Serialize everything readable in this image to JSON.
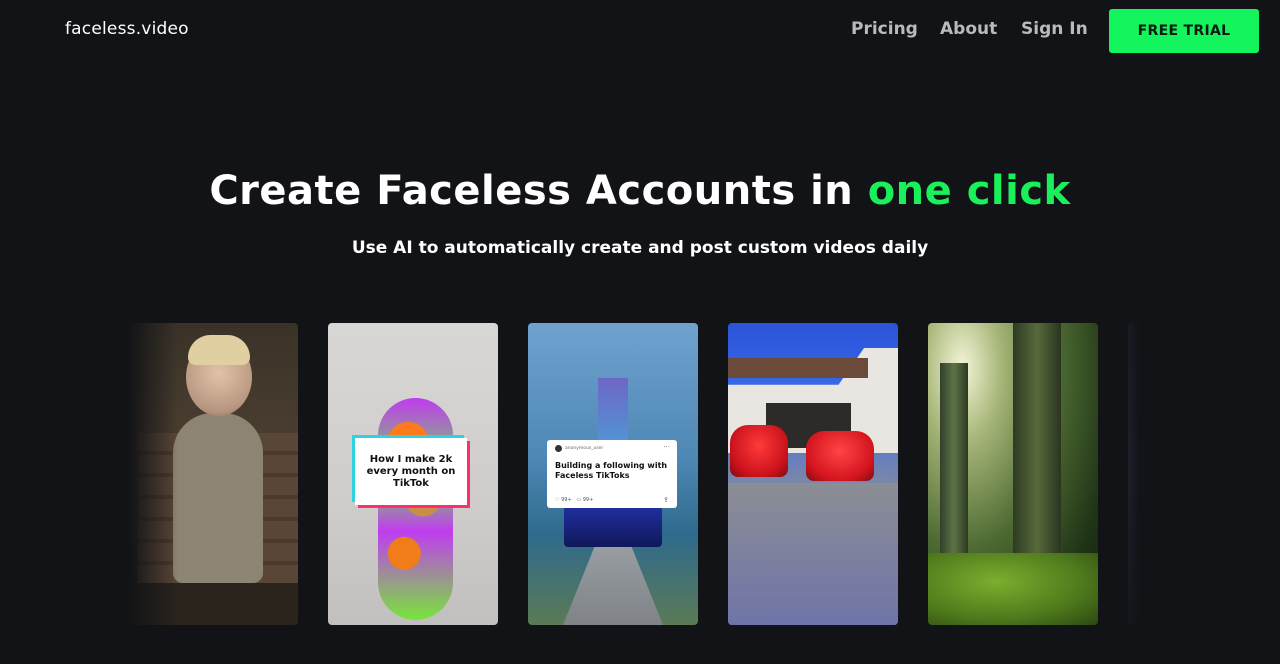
{
  "nav": {
    "logo": "faceless.video",
    "links": [
      "Pricing",
      "About",
      "Sign In"
    ],
    "cta": "FREE TRIAL",
    "accent_color": "#14f45c"
  },
  "hero": {
    "title_main": "Create Faceless Accounts in ",
    "title_accent": "one click",
    "subtitle": "Use AI to automatically create and post custom videos daily"
  },
  "carousel": {
    "cards": [
      {
        "caption": ""
      },
      {
        "caption": "How I make 2k every month on TikTok"
      },
      {
        "tweet_user": "anonymous_user",
        "tweet_text": "Building a following with Faceless TikToks",
        "tweet_likes": "99+",
        "tweet_comments": "99+"
      },
      {
        "caption": ""
      },
      {
        "caption": ""
      },
      {
        "caption": ""
      }
    ]
  }
}
